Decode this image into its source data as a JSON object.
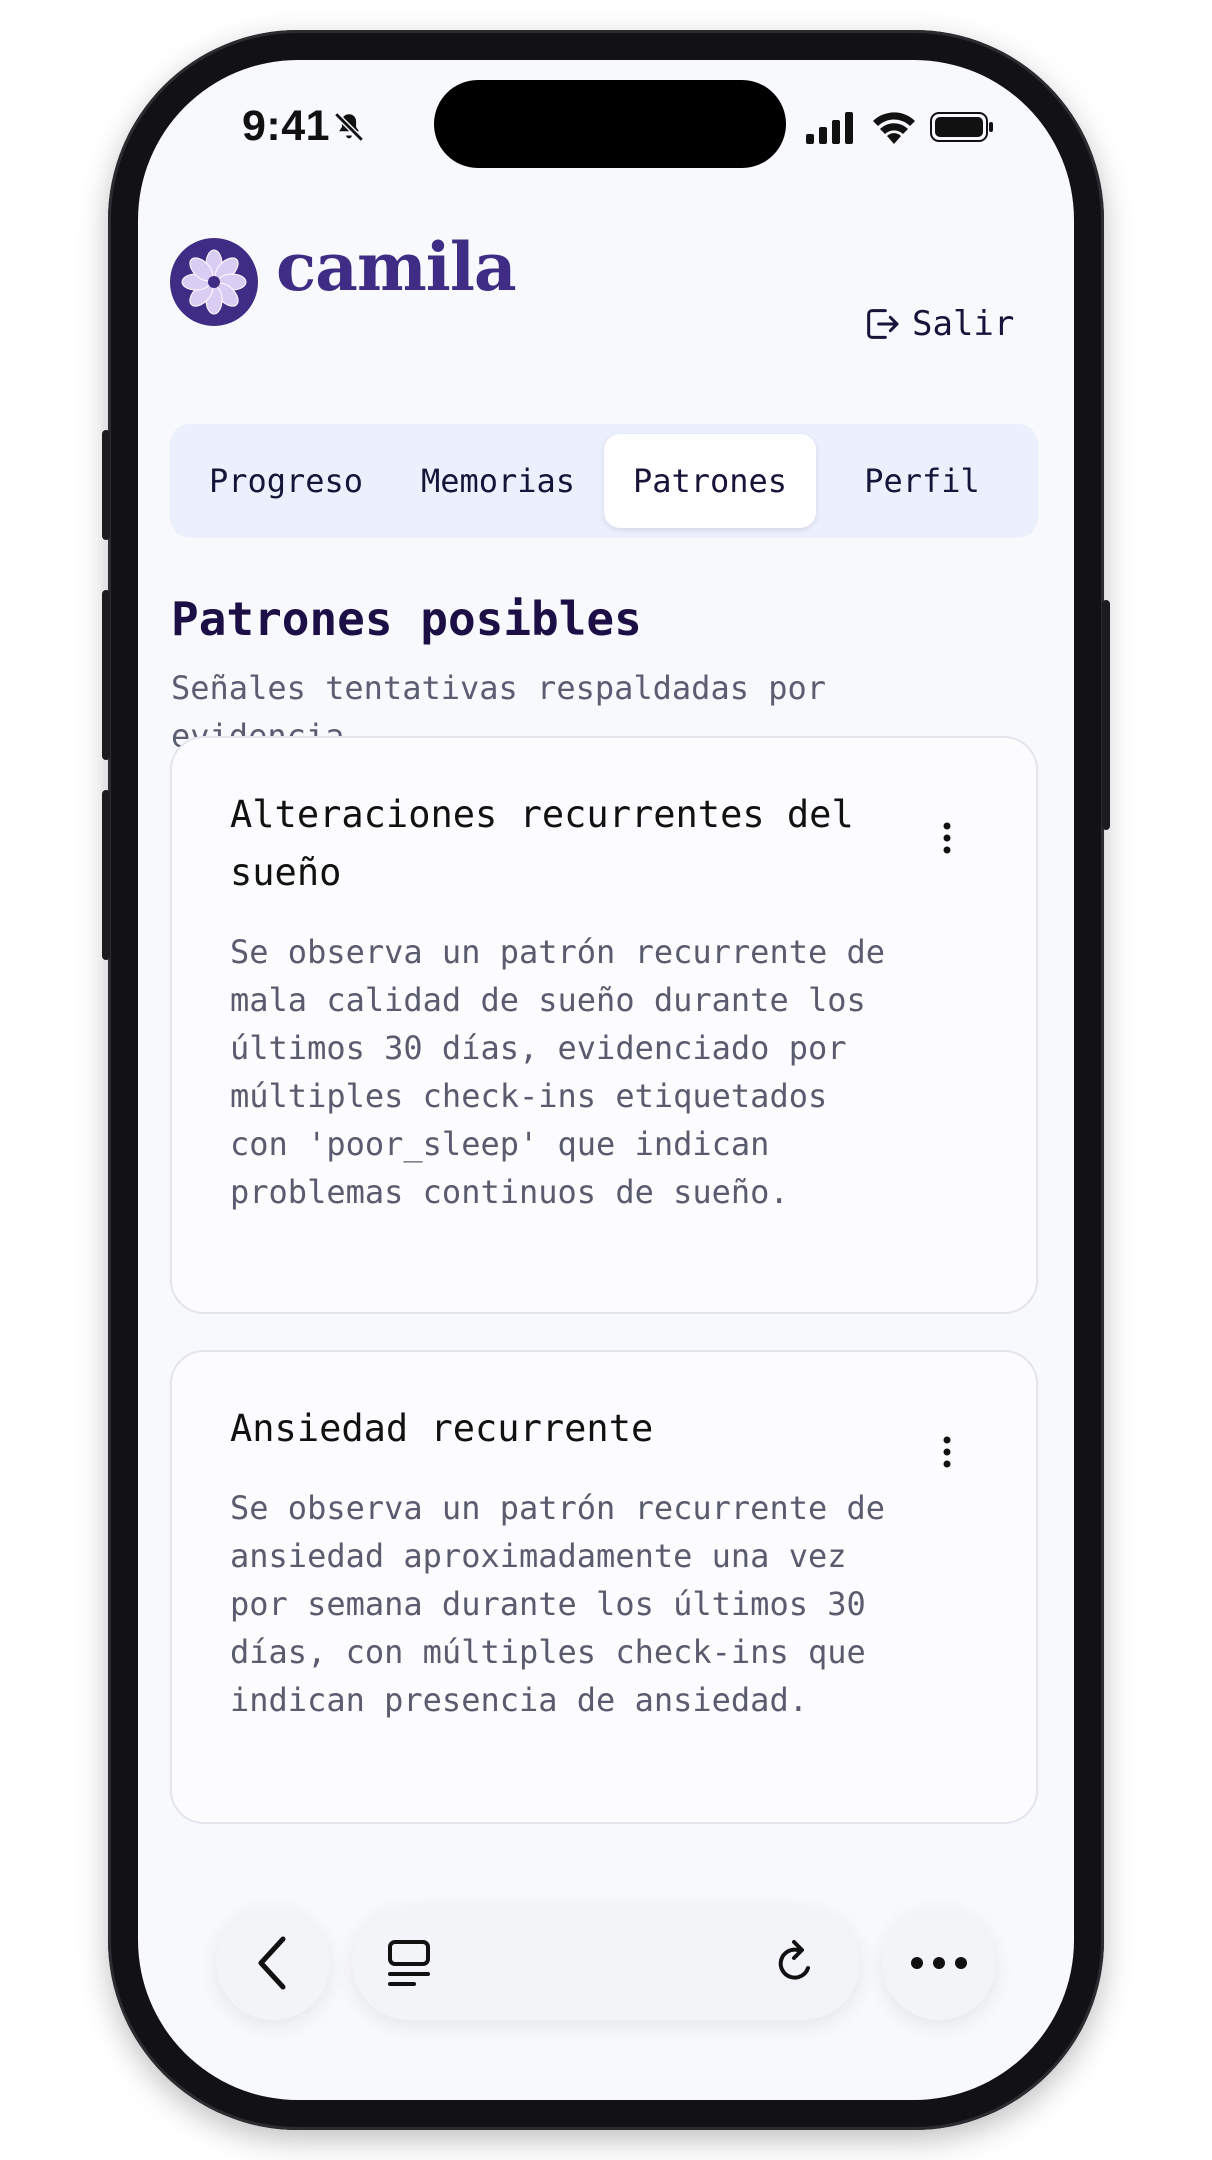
{
  "status_bar": {
    "time": "9:41"
  },
  "header": {
    "brand": "camila",
    "logout_label": "Salir"
  },
  "tabs": [
    {
      "label": "Progreso",
      "active": false
    },
    {
      "label": "Memorias",
      "active": false
    },
    {
      "label": "Patrones",
      "active": true
    },
    {
      "label": "Perfil",
      "active": false
    }
  ],
  "section": {
    "title": "Patrones posibles",
    "subtitle": "Señales tentativas respaldadas por evidencia."
  },
  "patterns": [
    {
      "title": "Alteraciones recurrentes del sueño",
      "description": "Se observa un patrón recurrente de mala calidad de sueño durante los últimos 30 días, evidenciado por múltiples check-ins etiquetados con 'poor_sleep' que indican problemas continuos de sueño."
    },
    {
      "title": "Ansiedad recurrente",
      "description": "Se observa un patrón recurrente de ansiedad aproximadamente una vez por semana durante los últimos 30 días, con múltiples check-ins que indican presencia de ansiedad."
    }
  ],
  "browser_bar": {
    "icons": [
      "back-arrow-icon",
      "tabs-icon",
      "reload-icon",
      "more-icon"
    ]
  },
  "colors": {
    "brand": "#3f2c84",
    "screen_bg": "#f8f9fd",
    "tab_bg": "#ecf0fd",
    "title_text": "#1b0f45",
    "body_text": "#5a5b6e"
  }
}
